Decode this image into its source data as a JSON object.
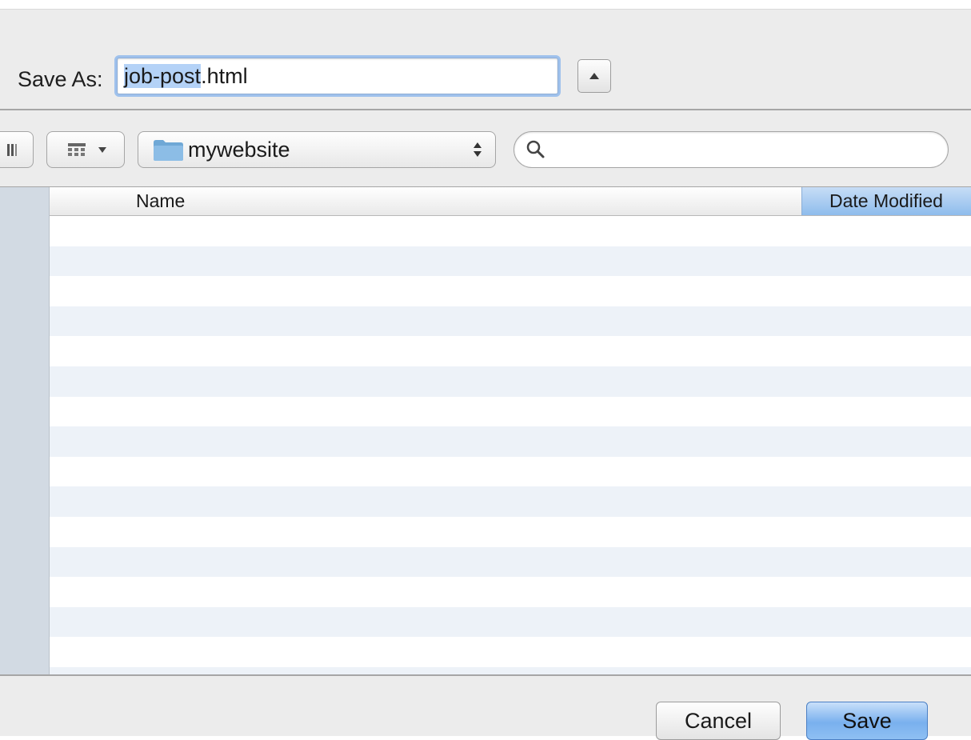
{
  "save_as": {
    "label": "Save As:",
    "filename_selected": "job-post",
    "filename_rest": ".html"
  },
  "toolbar": {
    "location": "mywebsite",
    "search_placeholder": ""
  },
  "file_list": {
    "columns": [
      "Name",
      "Date Modified"
    ],
    "sorted_column": "Date Modified",
    "rows": []
  },
  "buttons": {
    "cancel": "Cancel",
    "save": "Save"
  },
  "colors": {
    "accent": "#79b0ee",
    "selection": "#b4d2f7",
    "sidebar": "#d2dae3",
    "row_stripe": "#edf2f8"
  }
}
